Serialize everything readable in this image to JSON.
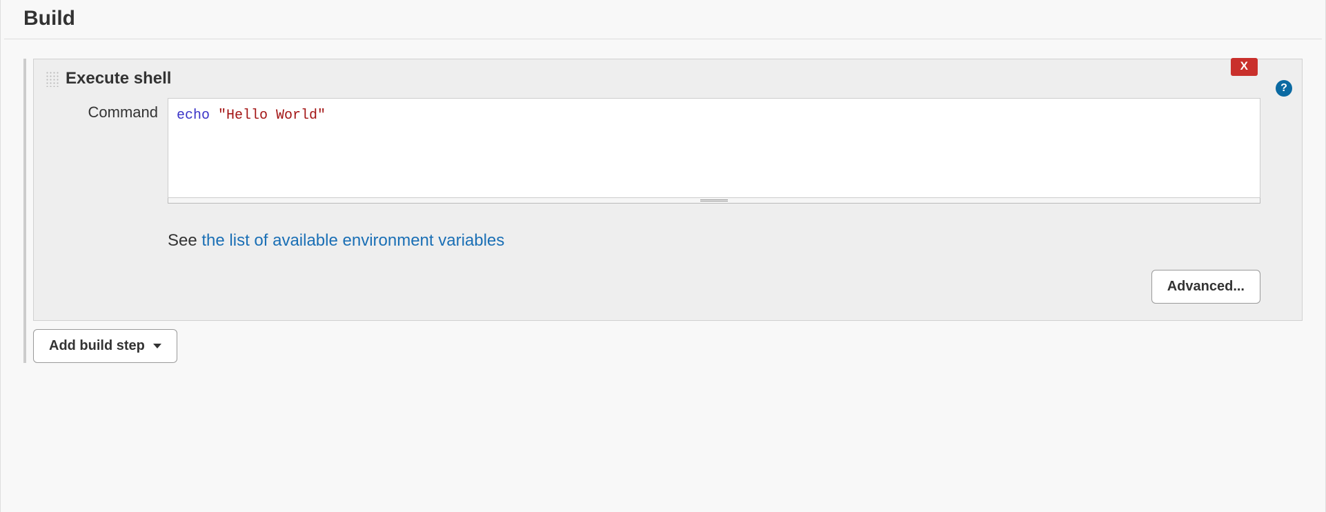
{
  "section": {
    "title": "Build"
  },
  "step": {
    "title": "Execute shell",
    "close_label": "X",
    "help_label": "?",
    "field_label": "Command",
    "command_keyword": "echo",
    "command_string": "\"Hello World\"",
    "help_prefix": "See ",
    "help_link_text": "the list of available environment variables",
    "advanced_label": "Advanced..."
  },
  "actions": {
    "add_step_label": "Add build step"
  }
}
